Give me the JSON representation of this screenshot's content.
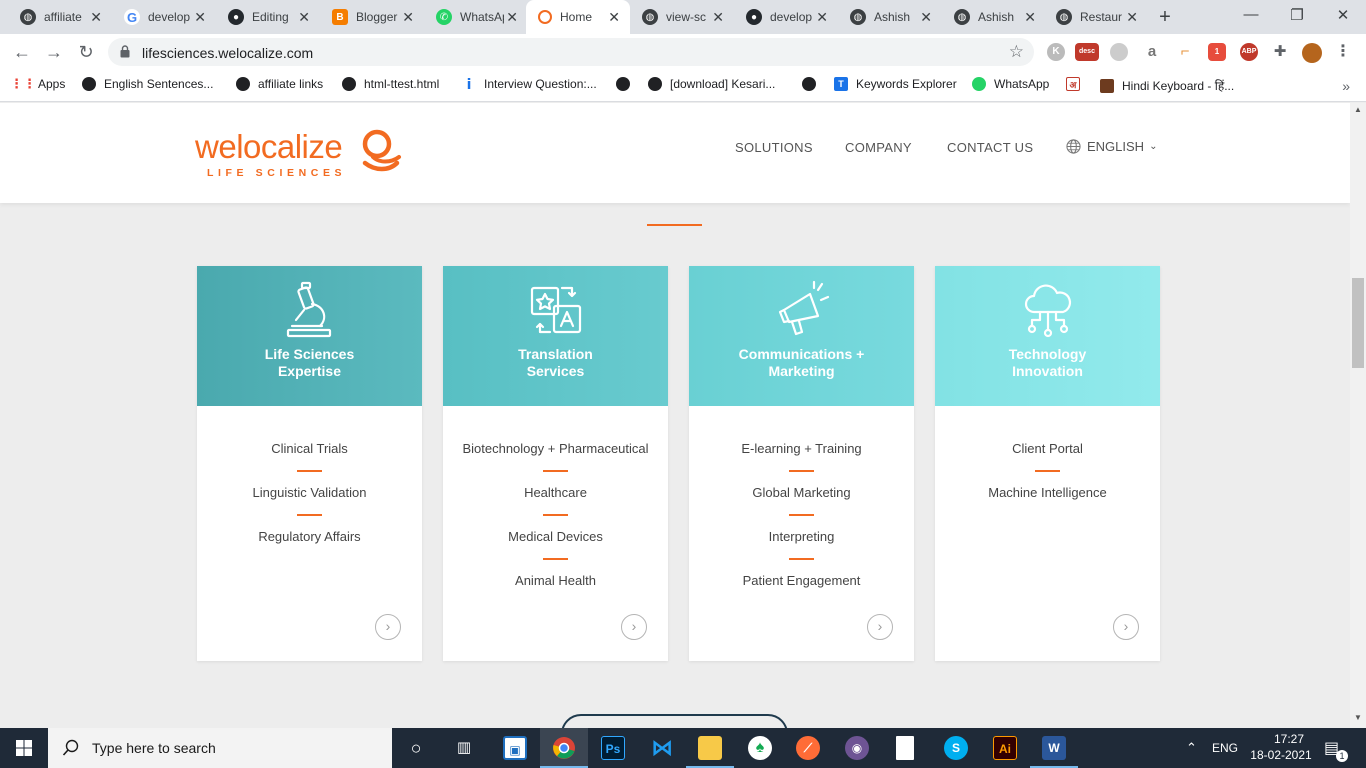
{
  "browser": {
    "tabs": [
      {
        "title": "affiliate",
        "icon": "globe-icon",
        "color": "#3c4043"
      },
      {
        "title": "develop",
        "icon": "google-icon",
        "color": "#4285f4"
      },
      {
        "title": "Editing",
        "icon": "github-icon",
        "color": "#24292e"
      },
      {
        "title": "Blogger",
        "icon": "blogger-icon",
        "color": "#f57d00"
      },
      {
        "title": "WhatsApp",
        "icon": "whatsapp-icon",
        "color": "#25d366"
      },
      {
        "title": "Home",
        "icon": "welocalize-icon",
        "color": "#f26b21"
      },
      {
        "title": "view-sc",
        "icon": "globe-icon",
        "color": "#3c4043"
      },
      {
        "title": "develop",
        "icon": "github-icon",
        "color": "#24292e"
      },
      {
        "title": "Ashish",
        "icon": "globe-icon",
        "color": "#3c4043"
      },
      {
        "title": "Ashish",
        "icon": "globe-icon",
        "color": "#3c4043"
      },
      {
        "title": "Restaur",
        "icon": "globe-icon",
        "color": "#3c4043"
      }
    ],
    "active_tab": 5,
    "url": "lifesciences.welocalize.com",
    "bookmarks": [
      {
        "label": "Apps",
        "icon": "apps-grid-icon"
      },
      {
        "label": "English Sentences...",
        "icon": "globe-icon"
      },
      {
        "label": "affiliate links",
        "icon": "globe-icon"
      },
      {
        "label": "html-ttest.html",
        "icon": "globe-icon"
      },
      {
        "label": "Interview Question:...",
        "icon": "info-icon"
      },
      {
        "label": "",
        "icon": "globe-icon"
      },
      {
        "label": "[download] Kesari...",
        "icon": "globe-icon"
      },
      {
        "label": "",
        "icon": "globe-icon"
      },
      {
        "label": "Keywords Explorer",
        "icon": "keywords-icon"
      },
      {
        "label": "WhatsApp",
        "icon": "whatsapp-icon"
      },
      {
        "label": "",
        "icon": "hindi-icon"
      },
      {
        "label": "Hindi Keyboard - हिं...",
        "icon": "pen-icon"
      }
    ],
    "ext_desc_label": "desc",
    "ext_abp_label": "ABP",
    "ext_badge": "1"
  },
  "site": {
    "logo_word": "welocalize",
    "logo_word_we": "we",
    "logo_word_rest": "localize",
    "logo_sub": "LIFE SCIENCES",
    "nav": [
      "SOLUTIONS",
      "COMPANY",
      "CONTACT US"
    ],
    "language": "ENGLISH",
    "accent": "#f26b21",
    "cards": [
      {
        "title_line1": "Life Sciences",
        "title_line2": "Expertise",
        "icon": "microscope-icon",
        "color": "#4fb0b5",
        "items": [
          "Clinical Trials",
          "Linguistic Validation",
          "Regulatory Affairs"
        ]
      },
      {
        "title_line1": "Translation",
        "title_line2": "Services",
        "icon": "translate-icon",
        "color": "#5ec5c8",
        "items": [
          "Biotechnology + Pharmaceutical",
          "Healthcare",
          "Medical Devices",
          "Animal Health"
        ]
      },
      {
        "title_line1": "Communications +",
        "title_line2": "Marketing",
        "icon": "megaphone-icon",
        "color": "#6fd5d8",
        "items": [
          "E-learning + Training",
          "Global Marketing",
          "Interpreting",
          "Patient Engagement"
        ]
      },
      {
        "title_line1": "Technology",
        "title_line2": "Innovation",
        "icon": "cloud-network-icon",
        "color": "#8ae5e7",
        "items": [
          "Client Portal",
          "Machine Intelligence"
        ]
      }
    ]
  },
  "taskbar": {
    "search_placeholder": "Type here to search",
    "apps": [
      "task-view-icon",
      "widgets-icon",
      "virtual-desktop-icon",
      "chrome-icon",
      "photoshop-icon",
      "vscode-icon",
      "file-explorer-icon",
      "mongodb-icon",
      "postman-icon",
      "github-desktop-icon",
      "notepad-icon",
      "skype-icon",
      "illustrator-icon",
      "word-icon"
    ],
    "ps_label": "Ps",
    "ai_label": "Ai",
    "skype_label": "S",
    "word_label": "W",
    "lang": "ENG",
    "time": "17:27",
    "date": "18-02-2021",
    "notif_count": "1"
  }
}
